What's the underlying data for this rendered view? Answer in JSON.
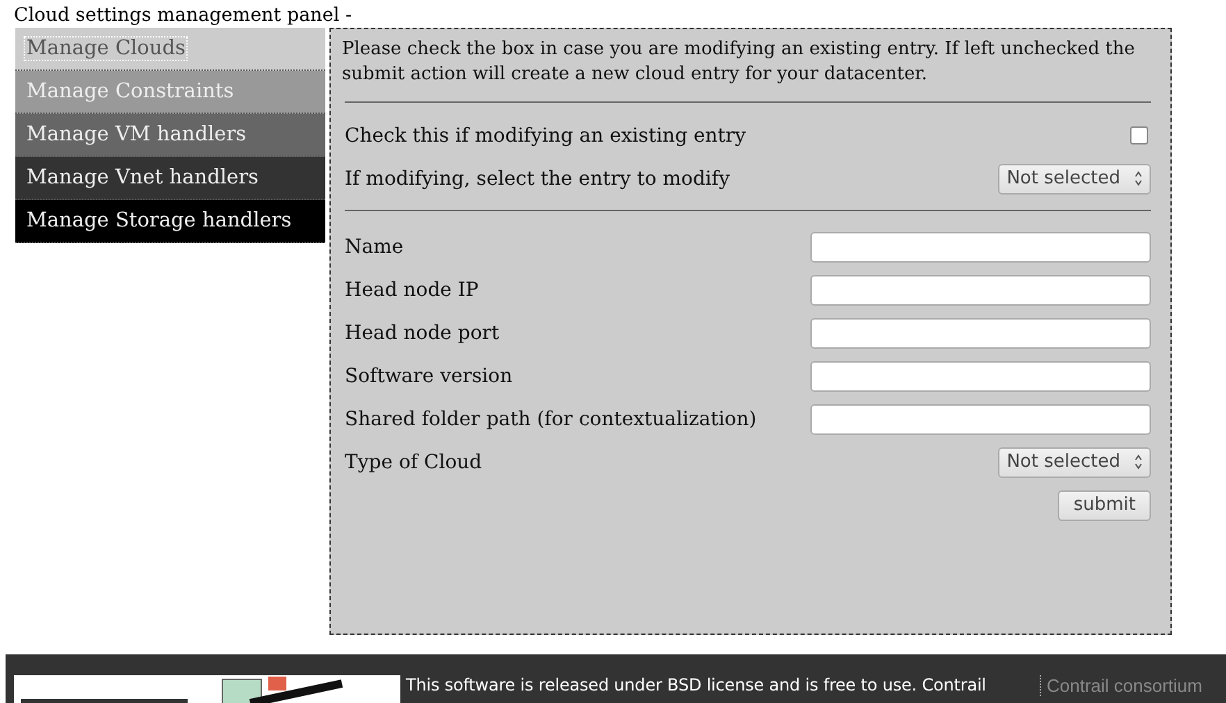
{
  "page_title": "Cloud settings management panel -",
  "menu": [
    {
      "label": "Manage Clouds",
      "selected": true,
      "color": "#cccccc"
    },
    {
      "label": "Manage Constraints",
      "selected": false,
      "color": "#999999"
    },
    {
      "label": "Manage VM handlers",
      "selected": false,
      "color": "#666666"
    },
    {
      "label": "Manage Vnet handlers",
      "selected": false,
      "color": "#333333"
    },
    {
      "label": "Manage Storage handlers",
      "selected": false,
      "color": "#000000"
    }
  ],
  "intro": "Please check the box in case you are modifying an existing entry. If left unchecked the submit action will create a new cloud entry for your datacenter.",
  "modify": {
    "check_label": "Check this if modifying an existing entry",
    "checked": false,
    "select_label": "If modifying, select the entry to modify",
    "select_value": "Not selected"
  },
  "fields": [
    {
      "kind": "text",
      "label": "Name"
    },
    {
      "kind": "text",
      "label": "Head node IP"
    },
    {
      "kind": "text",
      "label": "Head node port"
    },
    {
      "kind": "text",
      "label": "Software version"
    },
    {
      "kind": "text",
      "label": "Shared folder path (for contextualization)"
    },
    {
      "kind": "select",
      "label": "Type of Cloud",
      "value": "Not selected"
    }
  ],
  "submit": "submit",
  "footer": {
    "license": "This software is released under BSD license and is free to use. Contrail",
    "link": "Contrail consortium"
  }
}
